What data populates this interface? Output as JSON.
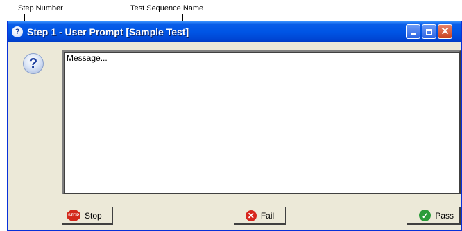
{
  "annotations": {
    "step_number": "Step Number",
    "sequence_name": "Test Sequence Name"
  },
  "window": {
    "title": "Step 1 - User Prompt [Sample Test]",
    "controls": {
      "minimize": "minimize",
      "maximize": "maximize",
      "close": "close"
    }
  },
  "message": {
    "text": "Message..."
  },
  "buttons": {
    "stop": {
      "label": "Stop",
      "icon": "stop-sign-icon"
    },
    "fail": {
      "label": "Fail",
      "icon": "red-x-circle-icon"
    },
    "pass": {
      "label": "Pass",
      "icon": "green-check-circle-icon"
    }
  },
  "colors": {
    "titlebar": "#0055e5",
    "window_face": "#ece9d8",
    "stop": "#d2281b",
    "fail": "#d7261d",
    "pass": "#2a9c3a"
  }
}
